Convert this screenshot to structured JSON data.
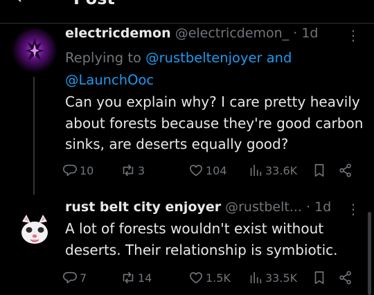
{
  "topbar": {
    "back_glyph": "←",
    "title": "Post"
  },
  "tweets": [
    {
      "display_name": "electricdemon",
      "handle": "@electricdemon_",
      "time": "· 1d",
      "replying_prefix": "Replying to ",
      "replying_user1": "@rustbeltenjoyer",
      "replying_and": " and",
      "replying_user2": "@LaunchOoc",
      "text": "Can you explain why? I care pretty heavily about forests because they're good carbon sinks, are deserts equally good?",
      "replies": "10",
      "reposts": "3",
      "likes": "104",
      "views": "33.6K"
    },
    {
      "display_name": "rust belt city enjoyer",
      "handle": "@rustbelt...",
      "time": "· 1d",
      "text": "A lot of forests wouldn't exist without deserts. Their relationship is symbiotic.",
      "replies": "7",
      "reposts": "14",
      "likes": "1.5K",
      "views": "33.5K"
    }
  ],
  "icons": [
    "more-icon",
    "reply-icon",
    "repost-icon",
    "like-icon",
    "views-icon",
    "bookmark-icon",
    "share-icon"
  ],
  "colors": {
    "background": "#000000",
    "text": "#e7e9ea",
    "secondary": "#71767b",
    "link": "#1d9bf0"
  }
}
